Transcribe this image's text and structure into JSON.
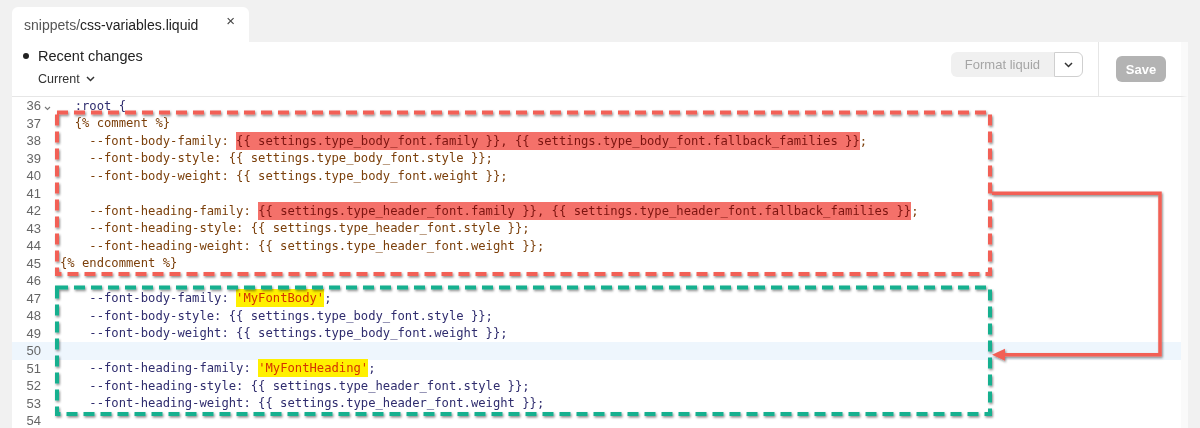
{
  "tab": {
    "label": "snippets/**css-variables.liquid**",
    "close": "×",
    "selected": true
  },
  "header": {
    "title": "Recent changes",
    "version": "Current"
  },
  "toolbar": {
    "format_button": {
      "label": "Format liquid",
      "disabled": true
    },
    "save_button": {
      "label": "Save",
      "disabled": true
    }
  },
  "editor": {
    "blocks": [
      {
        "lines": [
          {
            "number": "36",
            "kind": "code",
            "foldable": true,
            "active": false,
            "tokens": [
              {
                "text": "  :root {"
              }
            ]
          }
        ]
      },
      {
        "box": {
          "color": "#f26157"
        },
        "lines": [
          {
            "number": "37",
            "kind": "comment",
            "foldable": false,
            "active": false,
            "tokens": [
              {
                "text": "  {% comment %}"
              }
            ]
          },
          {
            "number": "38",
            "kind": "comment",
            "foldable": false,
            "active": false,
            "tokens": [
              {
                "text": "    --font-body-family: "
              },
              {
                "text": "{{ settings.type_body_font.family }}, {{ settings.type_body_font.fallback_families }}",
                "kind": "highlight",
                "color": "#f4716a"
              },
              {
                "text": ";"
              }
            ]
          },
          {
            "number": "39",
            "kind": "comment",
            "foldable": false,
            "active": false,
            "tokens": [
              {
                "text": "    --font-body-style: {{ settings.type_body_font.style }};"
              }
            ]
          },
          {
            "number": "40",
            "kind": "comment",
            "foldable": false,
            "active": false,
            "tokens": [
              {
                "text": "    --font-body-weight: {{ settings.type_body_font.weight }};"
              }
            ]
          },
          {
            "number": "41",
            "kind": "comment",
            "foldable": false,
            "active": false
          },
          {
            "number": "42",
            "kind": "comment",
            "foldable": false,
            "active": false,
            "tokens": [
              {
                "text": "    --font-heading-family: "
              },
              {
                "text": "{{ settings.type_header_font.family }}, {{ settings.type_header_font.fallback_families }}",
                "kind": "highlight",
                "color": "#f4716a"
              },
              {
                "text": ";"
              }
            ]
          },
          {
            "number": "43",
            "kind": "comment",
            "foldable": false,
            "active": false,
            "tokens": [
              {
                "text": "    --font-heading-style: {{ settings.type_header_font.style }};"
              }
            ]
          },
          {
            "number": "44",
            "kind": "comment",
            "foldable": false,
            "active": false,
            "tokens": [
              {
                "text": "    --font-heading-weight: {{ settings.type_header_font.weight }};"
              }
            ]
          },
          {
            "number": "45",
            "kind": "comment",
            "foldable": false,
            "active": false,
            "tokens": [
              {
                "text": "{% endcomment %}"
              }
            ]
          }
        ]
      },
      {
        "lines": [
          {
            "number": "46",
            "kind": "code",
            "foldable": false,
            "active": false
          }
        ]
      },
      {
        "box": {
          "color": "#14b08f"
        },
        "lines": [
          {
            "number": "47",
            "kind": "code",
            "foldable": false,
            "active": false,
            "tokens": [
              {
                "text": "    --font-body-family: "
              },
              {
                "text": "'MyFontBody'",
                "kind": "highlight",
                "color": "#fff000"
              },
              {
                "text": ";"
              }
            ]
          },
          {
            "number": "48",
            "kind": "code",
            "foldable": false,
            "active": false,
            "tokens": [
              {
                "text": "    --font-body-style: {{ settings.type_body_font.style }};"
              }
            ]
          },
          {
            "number": "49",
            "kind": "code",
            "foldable": false,
            "active": false,
            "tokens": [
              {
                "text": "    --font-body-weight: {{ settings.type_body_font.weight }};"
              }
            ]
          },
          {
            "number": "50",
            "kind": "code",
            "foldable": false,
            "active": true
          },
          {
            "number": "51",
            "kind": "code",
            "foldable": false,
            "active": false,
            "tokens": [
              {
                "text": "    --font-heading-family: "
              },
              {
                "text": "'MyFontHeading'",
                "kind": "highlight",
                "color": "#fff000"
              },
              {
                "text": ";"
              }
            ]
          },
          {
            "number": "52",
            "kind": "code",
            "foldable": false,
            "active": false,
            "tokens": [
              {
                "text": "    --font-heading-style: {{ settings.type_header_font.style }};"
              }
            ]
          },
          {
            "number": "53",
            "kind": "code",
            "foldable": false,
            "active": false,
            "tokens": [
              {
                "text": "    --font-heading-weight: {{ settings.type_header_font.weight }};"
              }
            ]
          }
        ]
      },
      {
        "lines": [
          {
            "number": "54",
            "kind": "code",
            "foldable": false,
            "active": false
          }
        ]
      }
    ]
  }
}
